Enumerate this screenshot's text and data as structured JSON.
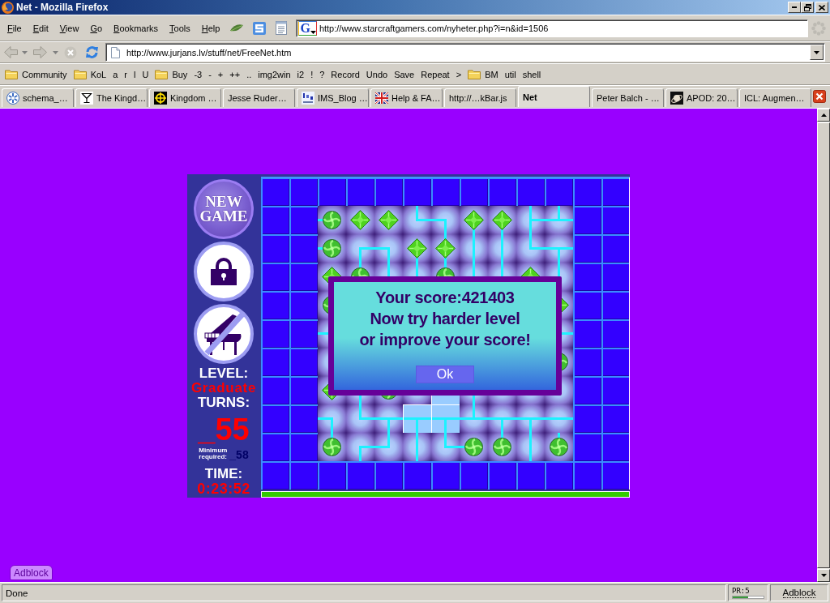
{
  "window": {
    "title": "Net - Mozilla Firefox"
  },
  "menu_bar": {
    "items": [
      "File",
      "Edit",
      "View",
      "Go",
      "Bookmarks",
      "Tools",
      "Help"
    ],
    "search_bar": {
      "engine": "G",
      "value": "http://www.starcraftgamers.com/nyheter.php?i=n&id=1506"
    }
  },
  "navigation": {
    "buttons": [
      {
        "kind": "back",
        "disabled": true
      },
      {
        "kind": "forward",
        "disabled": true
      },
      {
        "kind": "stop",
        "disabled": true
      },
      {
        "kind": "reload",
        "disabled": false
      }
    ],
    "address": "http://www.jurjans.lv/stuff/net/FreeNet.htm"
  },
  "bookmarks": [
    {
      "label": "Community",
      "kind": "folder"
    },
    {
      "label": "KoL",
      "kind": "folder"
    },
    {
      "label": "a",
      "kind": "link"
    },
    {
      "label": "r",
      "kind": "link"
    },
    {
      "label": "l",
      "kind": "link"
    },
    {
      "label": "U",
      "kind": "link"
    },
    {
      "label": "Buy",
      "kind": "folder"
    },
    {
      "label": "-3",
      "kind": "link"
    },
    {
      "label": "-",
      "kind": "link"
    },
    {
      "label": "+",
      "kind": "link"
    },
    {
      "label": "++",
      "kind": "link"
    },
    {
      "label": "..",
      "kind": "link"
    },
    {
      "label": "img2win",
      "kind": "link"
    },
    {
      "label": "i2",
      "kind": "link"
    },
    {
      "label": "!",
      "kind": "link"
    },
    {
      "label": "?",
      "kind": "link"
    },
    {
      "label": "Record",
      "kind": "link"
    },
    {
      "label": "Undo",
      "kind": "link"
    },
    {
      "label": "Save",
      "kind": "link"
    },
    {
      "label": "Repeat",
      "kind": "link"
    },
    {
      "label": ">",
      "kind": "link"
    },
    {
      "label": "BM",
      "kind": "folder"
    },
    {
      "label": "util",
      "kind": "link"
    },
    {
      "label": "shell",
      "kind": "link"
    }
  ],
  "tabs": [
    {
      "label": "schema_…",
      "selected": false
    },
    {
      "label": "The Kingd…",
      "selected": false
    },
    {
      "label": "Kingdom …",
      "selected": false
    },
    {
      "label": "Jesse Ruder…",
      "selected": false
    },
    {
      "label": "IMS_Blog …",
      "selected": false
    },
    {
      "label": "Help & FA…",
      "selected": false
    },
    {
      "label": "http://…kBar.js",
      "selected": false
    },
    {
      "label": "Net",
      "selected": true
    },
    {
      "label": "Peter Balch - …",
      "selected": false
    },
    {
      "label": "APOD: 20…",
      "selected": false
    },
    {
      "label": "ICL: Augmen…",
      "selected": false
    }
  ],
  "page": {
    "game": {
      "new_game_button": "NEW GAME",
      "music_button": {
        "muted": true
      },
      "level_label": "LEVEL:",
      "level_name": "Graduate",
      "turns_label": "TURNS:",
      "turns": "_55",
      "minimum_label": "Minimum required:",
      "minimum": "_58",
      "time_label": "TIME:",
      "time": "0:23:52",
      "board": {
        "rows": [
          [
            {
              "kind": "disc-w",
              "highlighted": false
            },
            {
              "kind": "diamond",
              "highlighted": false
            },
            {
              "kind": "diamond",
              "highlighted": false
            },
            {
              "kind": "wire-ne",
              "highlighted": false
            },
            {
              "kind": "wire-sw",
              "highlighted": false
            },
            {
              "kind": "diamond-s",
              "highlighted": false
            },
            {
              "kind": "diamond-s",
              "highlighted": false
            },
            {
              "kind": "wire-nes",
              "highlighted": false
            },
            {
              "kind": "wire-new",
              "highlighted": false
            }
          ],
          [
            {
              "kind": "disc-w",
              "highlighted": false
            },
            {
              "kind": "wire-es",
              "highlighted": false
            },
            {
              "kind": "wire-sw",
              "highlighted": false
            },
            {
              "kind": "diamond-s",
              "highlighted": false
            },
            {
              "kind": "diamond-ns",
              "highlighted": false
            },
            {
              "kind": "wire-ns",
              "highlighted": false
            },
            {
              "kind": "wire-ns",
              "highlighted": false
            },
            {
              "kind": "wire-ne",
              "highlighted": false
            },
            {
              "kind": "wire-esw",
              "highlighted": false
            }
          ],
          [
            {
              "kind": "diamond",
              "highlighted": false
            },
            {
              "kind": "disc-n",
              "highlighted": false
            },
            {
              "kind": "wire-n",
              "highlighted": false
            },
            {
              "kind": "wire-n",
              "highlighted": false
            },
            {
              "kind": "disc-n",
              "highlighted": false
            },
            {
              "kind": "wire-n",
              "highlighted": false
            },
            {
              "kind": "wire-n",
              "highlighted": false
            },
            {
              "kind": "diamond",
              "highlighted": false
            },
            {
              "kind": "wire-n",
              "highlighted": false
            }
          ],
          [
            {
              "kind": "disc",
              "highlighted": false
            },
            null,
            null,
            null,
            null,
            null,
            null,
            null,
            {
              "kind": "diamond",
              "highlighted": false
            }
          ],
          [
            {
              "kind": "wire-w",
              "highlighted": false
            },
            null,
            null,
            null,
            null,
            null,
            null,
            null,
            {
              "kind": "wire-e",
              "highlighted": false
            }
          ],
          [
            {
              "kind": "blank",
              "highlighted": false
            },
            null,
            null,
            null,
            null,
            null,
            null,
            null,
            {
              "kind": "disc",
              "highlighted": false
            }
          ],
          [
            {
              "kind": "diamond",
              "highlighted": false
            },
            {
              "kind": "wire-s",
              "highlighted": false
            },
            {
              "kind": "disc",
              "highlighted": false
            },
            {
              "kind": "blank",
              "highlighted": false
            },
            {
              "kind": "blank",
              "highlighted": true
            },
            {
              "kind": "wire-s",
              "highlighted": false
            },
            {
              "kind": "blank",
              "highlighted": false
            },
            {
              "kind": "blank",
              "highlighted": false
            },
            {
              "kind": "blank",
              "highlighted": false
            }
          ],
          [
            {
              "kind": "wire-sw",
              "highlighted": false
            },
            {
              "kind": "wire-ne",
              "highlighted": false
            },
            {
              "kind": "wire-esw",
              "highlighted": false
            },
            {
              "kind": "wire-esw",
              "highlighted": true
            },
            {
              "kind": "wire-esw",
              "highlighted": true
            },
            {
              "kind": "wire-new",
              "highlighted": false
            },
            {
              "kind": "wire-esw",
              "highlighted": false
            },
            {
              "kind": "wire-esw",
              "highlighted": false
            },
            {
              "kind": "wire-ew",
              "highlighted": false
            }
          ],
          [
            {
              "kind": "disc-n",
              "highlighted": false
            },
            {
              "kind": "wire-es",
              "highlighted": false
            },
            {
              "kind": "wire-nw",
              "highlighted": false
            },
            {
              "kind": "wire-ns",
              "highlighted": false
            },
            {
              "kind": "wire-ne",
              "highlighted": false
            },
            {
              "kind": "disc-w",
              "highlighted": false
            },
            {
              "kind": "disc-n",
              "highlighted": false
            },
            {
              "kind": "wire-ns",
              "highlighted": false
            },
            {
              "kind": "disc-n",
              "highlighted": false
            }
          ]
        ]
      },
      "progress_bar": {
        "level": 1
      },
      "dialog": {
        "score": "Your score:421403",
        "message_lines": [
          "Now try harder level",
          "or improve your score!"
        ],
        "button": "Ok"
      }
    },
    "adblock_tab": "Adblock"
  },
  "status_bar": {
    "text": "Done",
    "pagerank": {
      "label": "PR:5",
      "level": 0.5
    },
    "adblock": "Adblock"
  }
}
